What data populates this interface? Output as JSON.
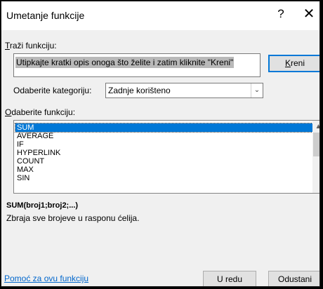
{
  "dialog": {
    "title": "Umetanje funkcije",
    "help_glyph": "?",
    "close_glyph": "✕"
  },
  "search": {
    "label": "Traži funkciju:",
    "value": "Utipkajte kratki opis onoga što želite i zatim kliknite \"Kreni\"",
    "go_button": "Kreni"
  },
  "category": {
    "label": "Odaberite kategoriju:",
    "selected": "Zadnje korišteno"
  },
  "functions": {
    "label": "Odaberite funkciju:",
    "items": [
      "SUM",
      "AVERAGE",
      "IF",
      "HYPERLINK",
      "COUNT",
      "MAX",
      "SIN"
    ],
    "selected": "SUM"
  },
  "details": {
    "syntax": "SUM(broj1;broj2;...)",
    "description": "Zbraja sve brojeve u rasponu ćelija."
  },
  "footer": {
    "help_link": "Pomoć za ovu funkciju",
    "ok_button": "U redu",
    "cancel_button": "Odustani"
  }
}
